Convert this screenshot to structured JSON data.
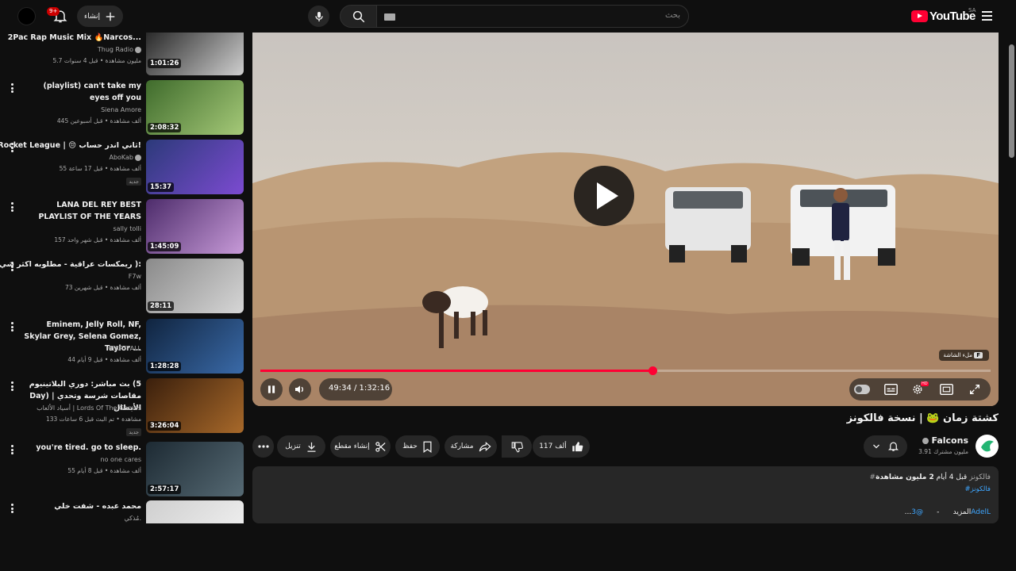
{
  "header": {
    "logo_text": "YouTube",
    "country_code": "SA",
    "search_placeholder": "بحث",
    "create_label": "إنشاء",
    "notification_count": "9+"
  },
  "sidebar": {
    "items": [
      {
        "title": "2Pac Rap Music Mix 🔥Narcos...",
        "channel": "Thug Radio",
        "verified": true,
        "meta": "5.7 مليون مشاهدة • قبل 4 سنوات",
        "duration": "1:01:26",
        "is_new": false,
        "thumb_colors": [
          "#1b1b1b",
          "#cfcfcf"
        ]
      },
      {
        "title": "(playlist) can't take my eyes off you",
        "channel": "Siena Amore",
        "verified": false,
        "meta": "445 ألف مشاهدة • قبل أسبوعين",
        "duration": "2:08:32",
        "is_new": false,
        "thumb_colors": [
          "#3f6b2c",
          "#a5c978"
        ]
      },
      {
        "title": "Rocket League | 😔 ثاني اندر حساب!",
        "channel": "AboKab",
        "verified": true,
        "meta": "55 ألف مشاهدة • قبل 17 ساعة",
        "duration": "15:37",
        "is_new": true,
        "thumb_colors": [
          "#2c3a7a",
          "#7c4bd1"
        ]
      },
      {
        "title": "LANA DEL REY BEST PLAYLIST OF THE YEARS",
        "channel": "sally tolli",
        "verified": false,
        "meta": "157 ألف مشاهدة • قبل شهر واحد",
        "duration": "1:45:09",
        "is_new": false,
        "thumb_colors": [
          "#4d2c6b",
          "#c79ad8"
        ]
      },
      {
        "title": "ريمكسات عراقية - مطلوبه اكثر شي ):",
        "channel": "F7w",
        "verified": false,
        "meta": "73 ألف مشاهدة • قبل شهرين",
        "duration": "28:11",
        "is_new": false,
        "thumb_colors": [
          "#8a8a8a",
          "#d6d6d6"
        ]
      },
      {
        "title": "Eminem, Jelly Roll, NF, Skylar Grey, Selena Gomez, Taylor ...",
        "channel": "HEARTFALL",
        "verified": false,
        "meta": "44 ألف مشاهدة • قبل 9 أيام",
        "duration": "1:28:28",
        "is_new": false,
        "thumb_colors": [
          "#10243f",
          "#3a6aa8"
        ]
      },
      {
        "title": "بث مباشر: دوري البلاتينيوم (5 Day) | مقاصات شرسة وتحدي الأبطال",
        "channel": "أسياد الألعاب | Lords Of The Games",
        "verified": false,
        "meta": "133 مشاهدة • تم البث قبل 6 ساعات",
        "duration": "3:26:04",
        "is_new": true,
        "thumb_colors": [
          "#3a1f0c",
          "#a8692a"
        ]
      },
      {
        "title": "you're tired. go to sleep.",
        "channel": "no one cares",
        "verified": false,
        "meta": "55 ألف مشاهدة • قبل 8 أيام",
        "duration": "2:57:17",
        "is_new": false,
        "thumb_colors": [
          "#1d2a33",
          "#566a74"
        ]
      },
      {
        "title": "محمد عبده - شفت خلي",
        "channel": "مُذكي.",
        "verified": false,
        "meta": "",
        "duration": "",
        "is_new": false,
        "thumb_colors": [
          "#cfcfcf",
          "#f4f4f4"
        ]
      }
    ]
  },
  "player": {
    "current_time": "49:34",
    "duration": "1:32:16",
    "time_display": "49:34 / 1:32:16",
    "progress": 0.537,
    "fullscreen_hint_key": "F",
    "fullscreen_hint_text": "ملء الشاشة",
    "hd_badge": "HD"
  },
  "video": {
    "title": "كشتة زمان 🐸 | نسخة فالكونز",
    "channel_name": "Falcons",
    "channel_verified": true,
    "subscribers": "3.91 مليون مشترك",
    "likes": "117 ألف",
    "share_label": "مشاركة",
    "save_label": "حفظ",
    "clip_label": "إنشاء مقطع",
    "download_label": "تنزيل"
  },
  "description": {
    "views": "2 مليون مشاهدة",
    "date": "قبل 4 أيام",
    "hashtag_inline": "#فالكونز",
    "hashtag_link": "#فالكونز",
    "mention": "@3AdelL",
    "separator": "-",
    "more_label": "...المزيد"
  }
}
